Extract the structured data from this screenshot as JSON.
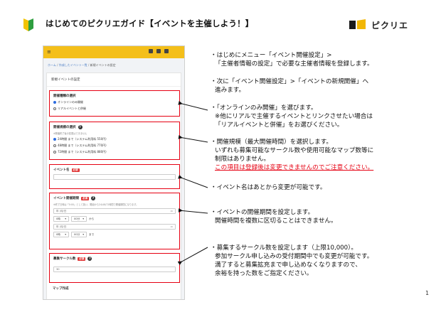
{
  "header": {
    "title": "はじめてのピクリエガイド【イベントを主催しよう！】",
    "brand_name": "ピクリエ",
    "colors": {
      "beginner_green": "#2e9e3f",
      "beginner_yellow": "#f2c300",
      "brand_dark": "#1a1a1a",
      "brand_yellow": "#f2b705"
    }
  },
  "app": {
    "menu_icon": "≡",
    "breadcrumb": {
      "home": "ホーム",
      "sep": " / ",
      "events": "作成したイベント一覧",
      "current": "新規イベントの設定"
    },
    "form_heading": "新規イベントの設定",
    "sec_type": {
      "title": "開催種類の選択",
      "options": [
        "オンラインのみ開催",
        "リアルイベントと併催"
      ]
    },
    "sec_scale": {
      "title": "開催規模の選択",
      "note": "※開催終了後の変更はできません",
      "options": [
        "24時間 まで（システム利用料 550円）",
        "48時間 まで（システム利用料 770円）",
        "72時間 まで（システム利用料 880円）"
      ]
    },
    "sec_name": {
      "title": "イベント名",
      "required": "必須"
    },
    "sec_period": {
      "title": "イベント開催期間",
      "required": "必須",
      "note": "※終了日時は「0:00」として扱い、開始から24/48/72時間で開催期間になります。",
      "date_placeholder": "年 /月/日",
      "hour": "0時",
      "minute": "00分",
      "from": "から",
      "to": "まで"
    },
    "sec_count": {
      "title": "募集サークル数",
      "required": "必須",
      "value": "30"
    },
    "map_title": "マップ作成"
  },
  "notes": {
    "n1": {
      "l1": "・はじめにメニュー「イベント開催設定」>",
      "l2": "「主催者情報の設定」で必要な主催者情報を登録します。"
    },
    "n2": {
      "l1": "・次に「イベント開催設定」>「イベントの新規開催」へ",
      "l2": "進みます。"
    },
    "n3": {
      "l1": "・「オンラインのみ開催」を選びます。",
      "l2": "※他にリアルで主催するイベントとリンクさせたい場合は",
      "l3": "「リアルイベントと併催」をお選びください。"
    },
    "n4": {
      "l1": "・開催規模（最大開催時間）を選択します。",
      "l2": "いずれも募集可能なサークル数や使用可能なマップ数等に",
      "l3": "制限はありません。",
      "warn": "この項目は登録後は変更できませんのでご注意ください。"
    },
    "n5": {
      "l1": "・イベント名はあとから変更が可能です。"
    },
    "n6": {
      "l1": "・イベントの開催期間を設定します。",
      "l2": "開催時間を複数に区切ることはできません。"
    },
    "n7": {
      "l1": "・募集するサークル数を設定します（上限10,000）。",
      "l2": "参加サークル申し込みの受付期間中でも変更が可能です。",
      "l3": "満了すると募集拡充まで申し込めなくなりますので、",
      "l4": "余裕を持った数をご指定ください。"
    }
  },
  "page_number": "1"
}
